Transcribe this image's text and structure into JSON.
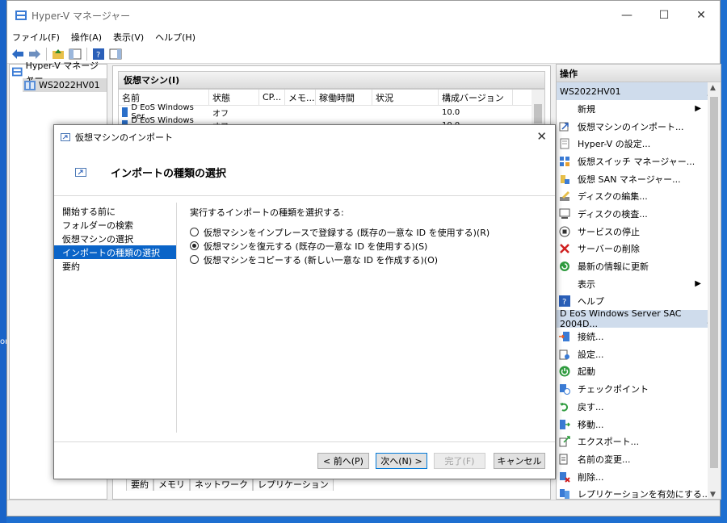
{
  "window": {
    "title": "Hyper-V マネージャー",
    "min_glyph": "—",
    "max_glyph": "☐",
    "close_glyph": "✕"
  },
  "menu": {
    "items": [
      "ファイル(F)",
      "操作(A)",
      "表示(V)",
      "ヘルプ(H)"
    ]
  },
  "tree": {
    "root": "Hyper-V マネージャー",
    "server": "WS2022HV01"
  },
  "vm_panel": {
    "title": "仮想マシン(I)",
    "columns": [
      "名前",
      "状態",
      "CP...",
      "メモ...",
      "稼働時間",
      "状況",
      "構成バージョン"
    ],
    "rows": [
      {
        "name": "D EoS Windows Ser...",
        "state": "オフ",
        "version": "10.0"
      },
      {
        "name": "D EoS Windows Ser...",
        "state": "オフ",
        "version": "10.0"
      }
    ],
    "bottom_tabs": [
      "要約",
      "メモリ",
      "ネットワーク",
      "レプリケーション"
    ]
  },
  "actions": {
    "title": "操作",
    "group1": {
      "label": "WS2022HV01",
      "items": [
        {
          "label": "新規",
          "icon": "none",
          "submenu": true
        },
        {
          "label": "仮想マシンのインポート...",
          "icon": "import-icon"
        },
        {
          "label": "Hyper-V の設定...",
          "icon": "settings-page-icon"
        },
        {
          "label": "仮想スイッチ マネージャー...",
          "icon": "switch-icon"
        },
        {
          "label": "仮想 SAN マネージャー...",
          "icon": "san-icon"
        },
        {
          "label": "ディスクの編集...",
          "icon": "disk-edit-icon"
        },
        {
          "label": "ディスクの検査...",
          "icon": "disk-inspect-icon"
        },
        {
          "label": "サービスの停止",
          "icon": "stop-icon"
        },
        {
          "label": "サーバーの削除",
          "icon": "delete-x-icon"
        },
        {
          "label": "最新の情報に更新",
          "icon": "refresh-icon"
        },
        {
          "label": "表示",
          "icon": "none",
          "submenu": true
        },
        {
          "label": "ヘルプ",
          "icon": "help-icon"
        }
      ]
    },
    "group2": {
      "label": "D EoS Windows Server SAC 2004D...",
      "items": [
        {
          "label": "接続...",
          "icon": "connect-icon"
        },
        {
          "label": "設定...",
          "icon": "vm-settings-icon"
        },
        {
          "label": "起動",
          "icon": "power-icon"
        },
        {
          "label": "チェックポイント",
          "icon": "checkpoint-icon"
        },
        {
          "label": "戻す...",
          "icon": "revert-icon"
        },
        {
          "label": "移動...",
          "icon": "move-icon"
        },
        {
          "label": "エクスポート...",
          "icon": "export-icon"
        },
        {
          "label": "名前の変更...",
          "icon": "rename-icon"
        },
        {
          "label": "削除...",
          "icon": "delete-icon"
        },
        {
          "label": "レプリケーションを有効にする...",
          "icon": "replication-icon"
        }
      ]
    }
  },
  "dialog": {
    "title": "仮想マシンのインポート",
    "heading": "インポートの種類の選択",
    "nav": [
      "開始する前に",
      "フォルダーの検索",
      "仮想マシンの選択",
      "インポートの種類の選択",
      "要約"
    ],
    "nav_selected": 3,
    "prompt": "実行するインポートの種類を選択する:",
    "options": [
      "仮想マシンをインプレースで登録する (既存の一意な ID を使用する)(R)",
      "仮想マシンを復元する (既存の一意な ID を使用する)(S)",
      "仮想マシンをコピーする (新しい一意な ID を作成する)(O)"
    ],
    "selected_option": 1,
    "buttons": {
      "back": "< 前へ(P)",
      "next": "次へ(N) >",
      "finish": "完了(F)",
      "cancel": "キャンセル"
    }
  },
  "desktop_edge_text": "or",
  "colors": {
    "selection": "#0a64c8",
    "desktop": "#1e6fd0",
    "group_header": "#cfdcec"
  }
}
